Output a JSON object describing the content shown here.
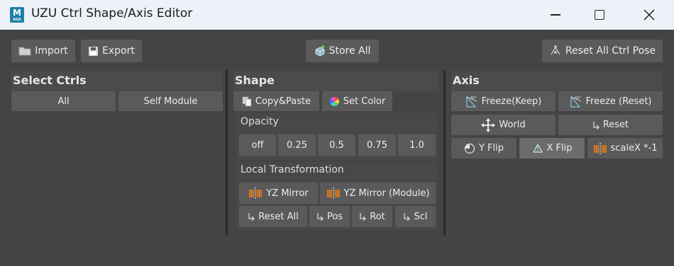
{
  "window": {
    "title": "UZU Ctrl Shape/Axis Editor",
    "icon_letter": "M",
    "icon_sub": "ASA"
  },
  "toolbar": {
    "import_label": "Import",
    "export_label": "Export",
    "store_all_label": "Store All",
    "reset_all_label": "Reset All Ctrl Pose"
  },
  "select_ctrls": {
    "title": "Select Ctrls",
    "all_label": "All",
    "self_module_label": "Self Module"
  },
  "shape": {
    "title": "Shape",
    "copy_paste_label": "Copy&Paste",
    "set_color_label": "Set Color",
    "opacity_label": "Opacity",
    "opacity_options": [
      "off",
      "0.25",
      "0.5",
      "0.75",
      "1.0"
    ],
    "local_transform_label": "Local Transformation",
    "yz_mirror_label": "YZ Mirror",
    "yz_mirror_module_label": "YZ Mirror (Module)",
    "reset_all_label": "Reset All",
    "pos_label": "Pos",
    "rot_label": "Rot",
    "scl_label": "Scl"
  },
  "axis": {
    "title": "Axis",
    "freeze_keep_label": "Freeze(Keep)",
    "freeze_reset_label": "Freeze (Reset)",
    "world_label": "World",
    "reset_label": "Reset",
    "y_flip_label": "Y Flip",
    "x_flip_label": "X Flip",
    "scalex_label": "scaleX *-1"
  },
  "colors": {
    "background": "#444444",
    "button": "#5a5a5a",
    "titlebar": "#eef1f7",
    "accent_orange": "#d9822b"
  },
  "icons": [
    "folder-icon",
    "save-icon",
    "cube-plus-icon",
    "reset-pose-icon",
    "copy-icon",
    "color-wheel-icon",
    "mirror-icon",
    "arrow-corner-icon",
    "freeze-icon",
    "move-icon",
    "y-flip-icon",
    "x-flip-icon"
  ]
}
